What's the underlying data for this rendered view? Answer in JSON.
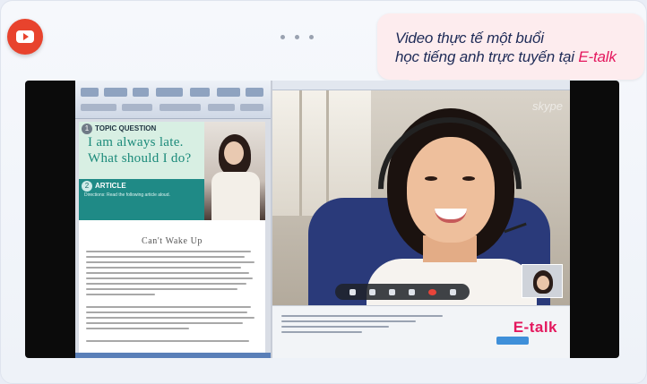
{
  "bubble": {
    "line1": "Video thực tế một buổi",
    "line2_prefix": "học tiếng anh trực tuyến tại ",
    "brand": "E-talk"
  },
  "lesson": {
    "topic_number": "1",
    "topic_label": "TOPIC QUESTION",
    "question_line1": "I am always late.",
    "question_line2": "What should I do?",
    "article_number": "2",
    "article_label": "ARTICLE",
    "article_directions": "Directions: Read the following article aloud.",
    "article_title": "Can't Wake Up"
  },
  "skype": {
    "app_name": "skype"
  },
  "watermark": {
    "logo_text": "E-talk"
  },
  "colors": {
    "brand_pink": "#e4185e",
    "title_navy": "#1e2b57",
    "youtube_red": "#e8432d",
    "topic_teal": "#1b8a7a"
  },
  "icons": [
    "youtube-icon",
    "more-dots-icon",
    "hangup-icon"
  ]
}
